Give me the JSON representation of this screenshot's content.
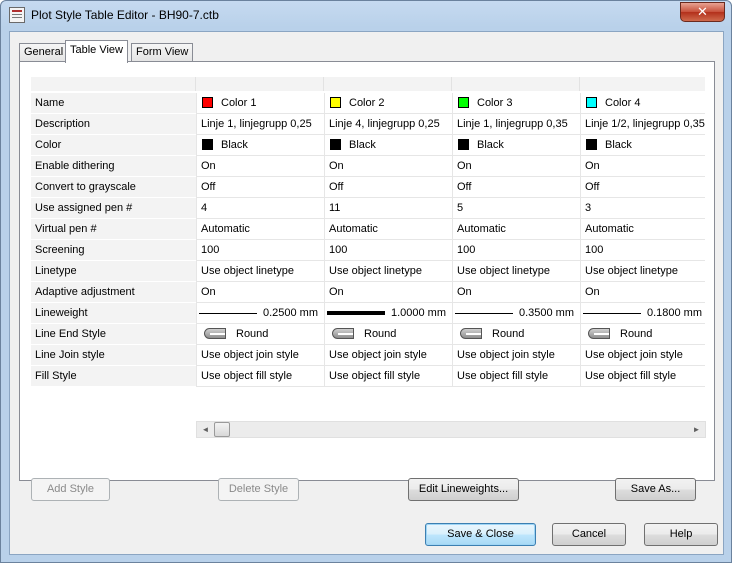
{
  "window": {
    "title": "Plot Style Table Editor - BH90-7.ctb",
    "close_glyph": "✕"
  },
  "tabs": [
    {
      "label": "General"
    },
    {
      "label": "Table View"
    },
    {
      "label": "Form View"
    }
  ],
  "grid": {
    "row_labels": [
      "Name",
      "Description",
      "Color",
      "Enable dithering",
      "Convert to grayscale",
      "Use assigned pen #",
      "Virtual pen #",
      "Screening",
      "Linetype",
      "Adaptive adjustment",
      "Lineweight",
      "Line End Style",
      "Line Join style",
      "Fill Style"
    ],
    "columns": [
      {
        "name": "Color 1",
        "swatch": "#ff0000",
        "description": "Linje 1, linjegrupp 0,25",
        "color": "Black",
        "color_swatch": "#000000",
        "dithering": "On",
        "grayscale": "Off",
        "pen": "4",
        "virtual_pen": "Automatic",
        "screening": "100",
        "linetype": "Use object linetype",
        "adaptive": "On",
        "lineweight": "0.2500 mm",
        "lineweight_value": 0.25,
        "end_style": "Round",
        "join_style": "Use object join style",
        "fill_style": "Use object fill style"
      },
      {
        "name": "Color 2",
        "swatch": "#ffff00",
        "description": "Linje 4, linjegrupp 0,25",
        "color": "Black",
        "color_swatch": "#000000",
        "dithering": "On",
        "grayscale": "Off",
        "pen": "11",
        "virtual_pen": "Automatic",
        "screening": "100",
        "linetype": "Use object linetype",
        "adaptive": "On",
        "lineweight": "1.0000 mm",
        "lineweight_value": 1.0,
        "end_style": "Round",
        "join_style": "Use object join style",
        "fill_style": "Use object fill style"
      },
      {
        "name": "Color 3",
        "swatch": "#00ff00",
        "description": "Linje 1, linjegrupp 0,35",
        "color": "Black",
        "color_swatch": "#000000",
        "dithering": "On",
        "grayscale": "Off",
        "pen": "5",
        "virtual_pen": "Automatic",
        "screening": "100",
        "linetype": "Use object linetype",
        "adaptive": "On",
        "lineweight": "0.3500 mm",
        "lineweight_value": 0.35,
        "end_style": "Round",
        "join_style": "Use object join style",
        "fill_style": "Use object fill style"
      },
      {
        "name": "Color 4",
        "swatch": "#00ffff",
        "description": "Linje 1/2, linjegrupp 0,35",
        "color": "Black",
        "color_swatch": "#000000",
        "dithering": "On",
        "grayscale": "Off",
        "pen": "3",
        "virtual_pen": "Automatic",
        "screening": "100",
        "linetype": "Use object linetype",
        "adaptive": "On",
        "lineweight": "0.1800 mm",
        "lineweight_value": 0.18,
        "end_style": "Round",
        "join_style": "Use object join style",
        "fill_style": "Use object fill style"
      }
    ]
  },
  "scrollbar": {
    "left_glyph": "◄",
    "right_glyph": "►"
  },
  "panel_buttons": {
    "add_style": "Add Style",
    "delete_style": "Delete Style",
    "edit_lineweights": "Edit Lineweights...",
    "save_as": "Save As..."
  },
  "dialog_buttons": {
    "save_close": "Save & Close",
    "cancel": "Cancel",
    "help": "Help"
  }
}
